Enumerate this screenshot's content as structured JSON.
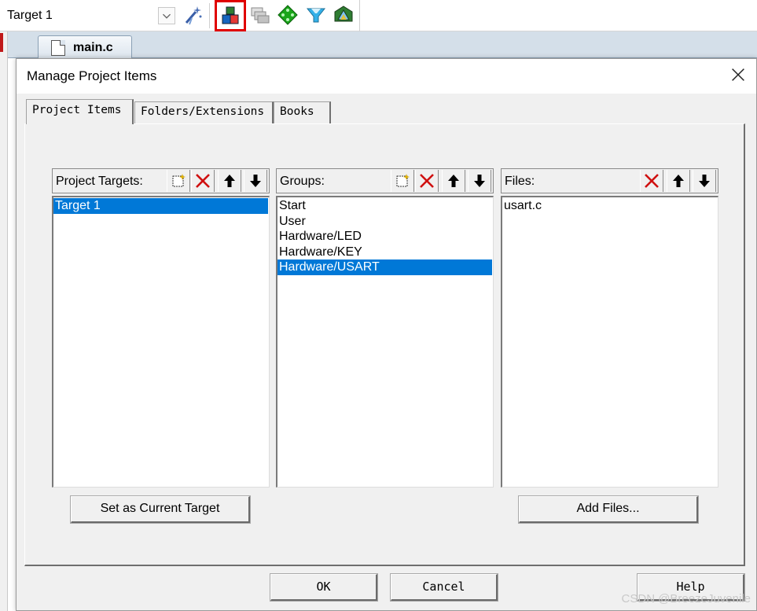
{
  "toolbar": {
    "target_value": "Target 1",
    "icons": [
      "options-wand-icon",
      "manage-project-items-icon",
      "select-packs-icon",
      "manage-runtime-icon",
      "pack-installer-icon",
      "component-icon"
    ],
    "highlight_color": "#e00000"
  },
  "editor": {
    "file_tab": "main.c"
  },
  "dialog": {
    "title": "Manage Project Items",
    "tabs": [
      "Project Items",
      "Folders/Extensions",
      "Books"
    ],
    "active_tab": "Project Items",
    "targets": {
      "header": "Project Targets:",
      "items": [
        "Target 1"
      ],
      "selected": "Target 1",
      "set_current_label": "Set as Current Target"
    },
    "groups": {
      "header": "Groups:",
      "items": [
        "Start",
        "User",
        "Hardware/LED",
        "Hardware/KEY",
        "Hardware/USART"
      ],
      "selected": "Hardware/USART"
    },
    "files": {
      "header": "Files:",
      "items": [
        "usart.c"
      ],
      "add_files_label": "Add Files..."
    },
    "ok_label": "OK",
    "cancel_label": "Cancel",
    "help_label": "Help",
    "selection_color": "#0078d7"
  },
  "watermark": "CSDN @BreezeJuvenile"
}
